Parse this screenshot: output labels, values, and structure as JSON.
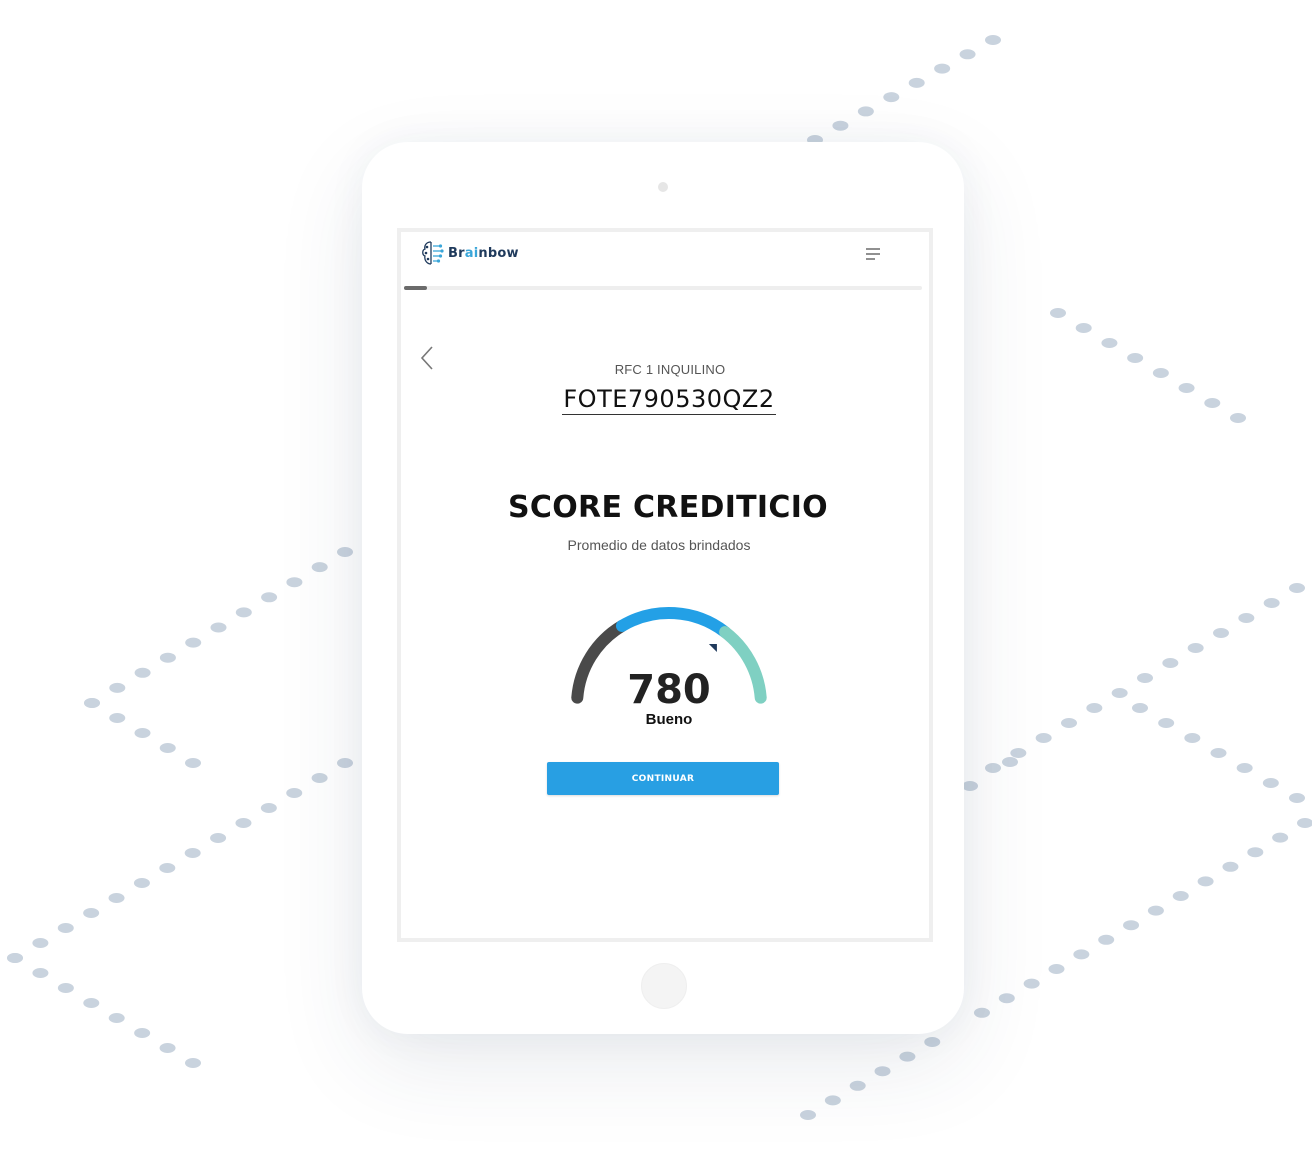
{
  "app": {
    "brand_prefix": "Br",
    "brand_highlight": "ai",
    "brand_suffix": "nbow"
  },
  "progress": {
    "fraction": 0.045
  },
  "rfc": {
    "label": "RFC 1 INQUILINO",
    "value": "FOTE790530QZ2"
  },
  "score": {
    "title": "SCORE CREDITICIO",
    "subtitle": "Promedio de datos brindados",
    "value": "780",
    "rating": "Bueno"
  },
  "gauge": {
    "segments": [
      {
        "color": "#4a4a4a",
        "from": 0.0,
        "to": 0.32
      },
      {
        "color": "#23a0e6",
        "from": 0.32,
        "to": 0.72
      },
      {
        "color": "#7fd0c2",
        "from": 0.72,
        "to": 1.0
      }
    ],
    "pointer_fraction": 0.72,
    "pointer_color": "#1f3a5c"
  },
  "actions": {
    "continue_label": "CONTINUAR"
  },
  "icons": {
    "back": "chevron-left-icon",
    "menu": "hamburger-menu-icon",
    "logo": "brain-circuit-logo-icon"
  }
}
